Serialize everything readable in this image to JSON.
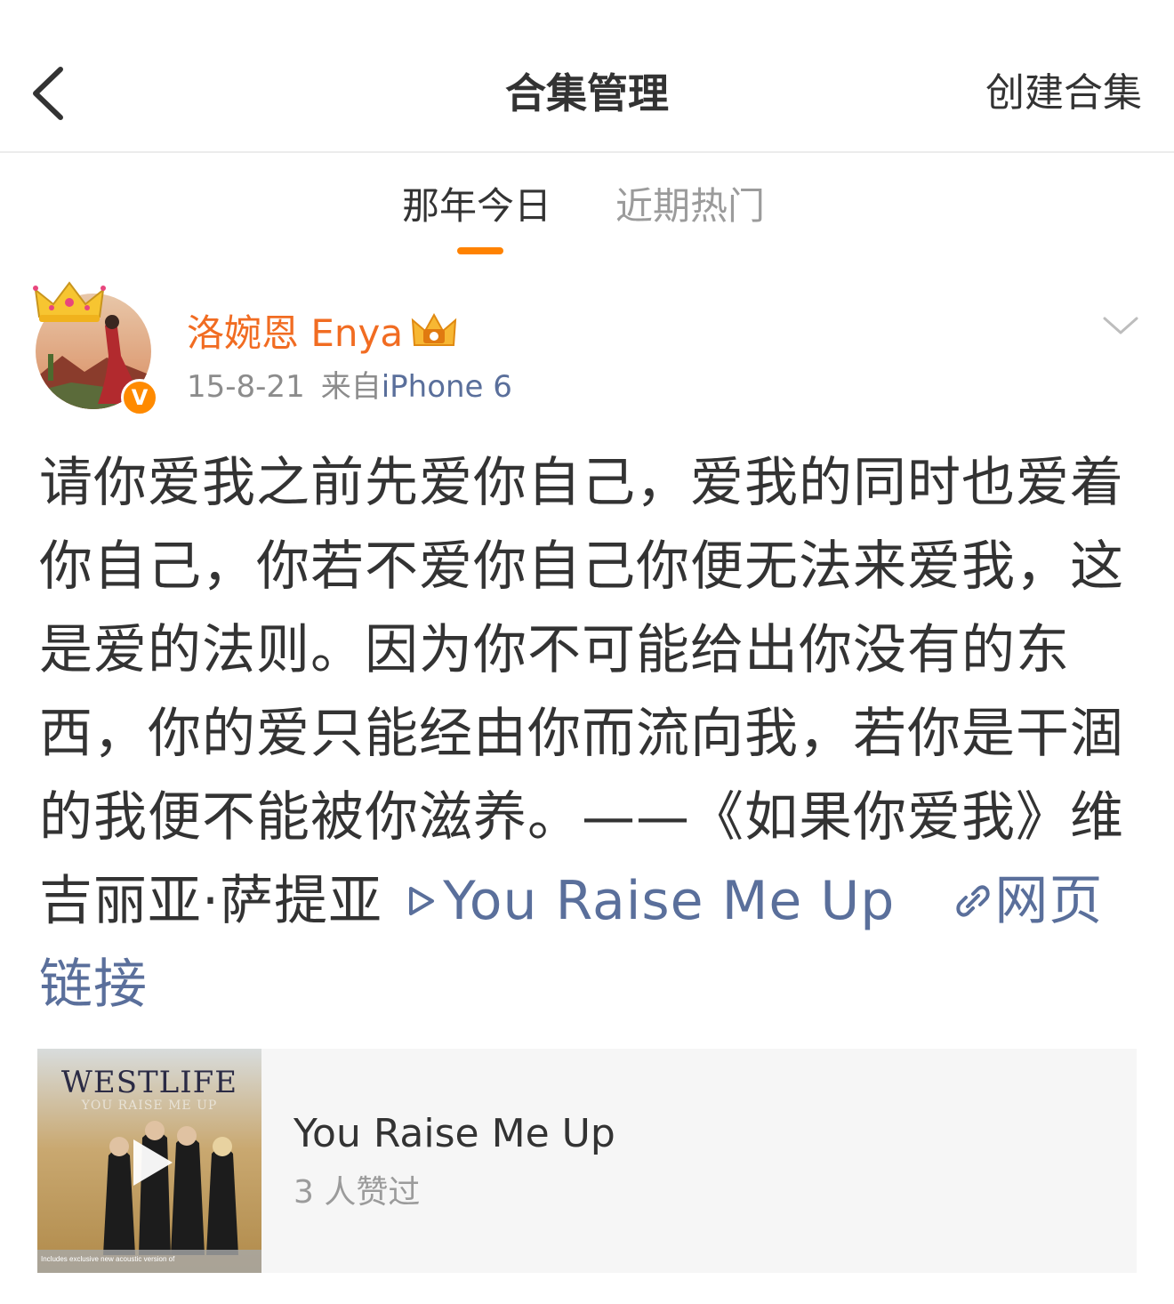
{
  "navbar": {
    "back_icon": "chevron-left-icon",
    "title": "合集管理",
    "create_label": "创建合集"
  },
  "tabs": [
    {
      "label": "那年今日",
      "active": true
    },
    {
      "label": "近期热门",
      "active": false
    }
  ],
  "colors": {
    "accent": "#ff8200",
    "username": "#f16c22",
    "link": "#5a6f9b",
    "muted": "#9b9b9b"
  },
  "post": {
    "username": "洛婉恩 Enya",
    "date": "15-8-21",
    "from_label": "来自",
    "device": "iPhone 6",
    "text": "请你爱我之前先爱你自己，爱我的同时也爱着你自己，你若不爱你自己你便无法来爱我，这是爱的法则。因为你不可能给出你没有的东西，你的爱只能经由你而流向我，若你是干涸的我便不能被你滋养。——《如果你爱我》维吉丽亚·萨提亚",
    "music_link": "You Raise Me Up",
    "web_link": "网页链接",
    "verified_mark": "V"
  },
  "media_card": {
    "cover_title": "WESTLIFE",
    "cover_subtitle": "YOU RAISE ME UP",
    "cover_note": "Includes exclusive new acoustic version of",
    "title": "You Raise Me Up",
    "likes": "3 人赞过"
  }
}
